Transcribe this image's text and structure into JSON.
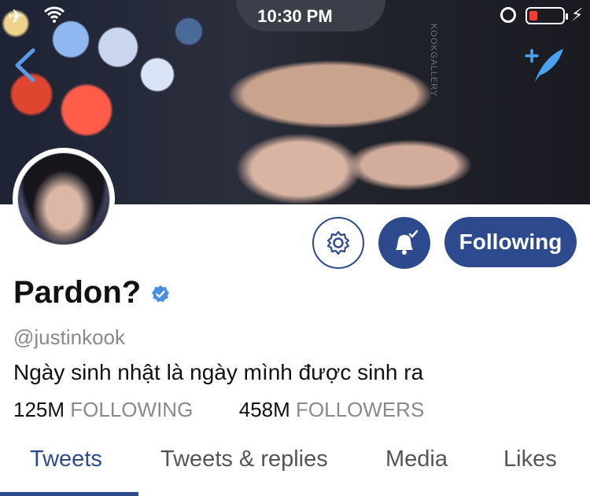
{
  "status_bar": {
    "time": "10:30 PM",
    "icons": [
      "airplane-icon",
      "wifi-icon",
      "rotation-lock-icon",
      "battery-icon",
      "charging-bolt-icon"
    ],
    "battery_color": "#ff3b30"
  },
  "banner": {
    "watermark": "KOOKGALLERY"
  },
  "nav": {
    "back_icon": "chevron-left-icon",
    "compose_icon": "compose-feather-icon"
  },
  "profile": {
    "display_name": "Pardon?",
    "verified": true,
    "handle": "@justinkook",
    "bio": "Ngày sinh nhật là ngày mình được sinh ra",
    "following_count": "125M",
    "following_label": "FOLLOWING",
    "followers_count": "458M",
    "followers_label": "FOLLOWERS"
  },
  "actions": {
    "settings_icon": "gear-icon",
    "notifications_icon": "bell-check-icon",
    "follow_label": "Following"
  },
  "tabs": [
    {
      "label": "Tweets",
      "active": true
    },
    {
      "label": "Tweets & replies",
      "active": false
    },
    {
      "label": "Media",
      "active": false
    },
    {
      "label": "Likes",
      "active": false
    }
  ],
  "colors": {
    "accent": "#2d4a8f",
    "verified": "#4a90e2",
    "muted_text": "#8a8a8a"
  }
}
